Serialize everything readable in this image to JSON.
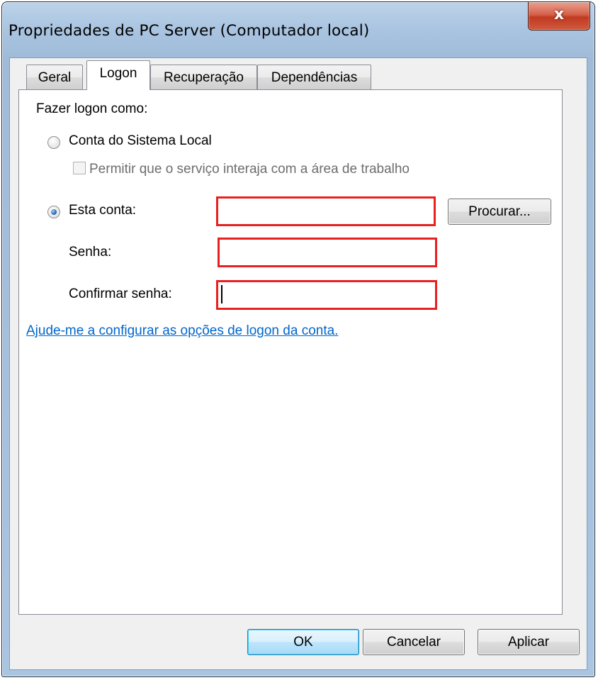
{
  "window": {
    "title": "Propriedades de PC Server (Computador local)",
    "close_glyph": "x"
  },
  "tabs": [
    {
      "label": "Geral",
      "active": false
    },
    {
      "label": "Logon",
      "active": true
    },
    {
      "label": "Recuperação",
      "active": false
    },
    {
      "label": "Dependências",
      "active": false
    }
  ],
  "logon": {
    "heading": "Fazer logon como:",
    "local_system_label": "Conta do Sistema Local",
    "interact_desktop_label": "Permitir que o serviço interaja com a área de trabalho",
    "this_account_label": "Esta conta:",
    "account_value": "",
    "browse_label": "Procurar...",
    "password_label": "Senha:",
    "password_value": "",
    "confirm_password_label": "Confirmar senha:",
    "confirm_password_value": "",
    "help_link": "Ajude-me a configurar as opções de logon da conta."
  },
  "footer": {
    "ok_label": "OK",
    "cancel_label": "Cancelar",
    "apply_label": "Aplicar"
  },
  "colors": {
    "highlight_border": "#e8201f",
    "link": "#0066cc"
  }
}
